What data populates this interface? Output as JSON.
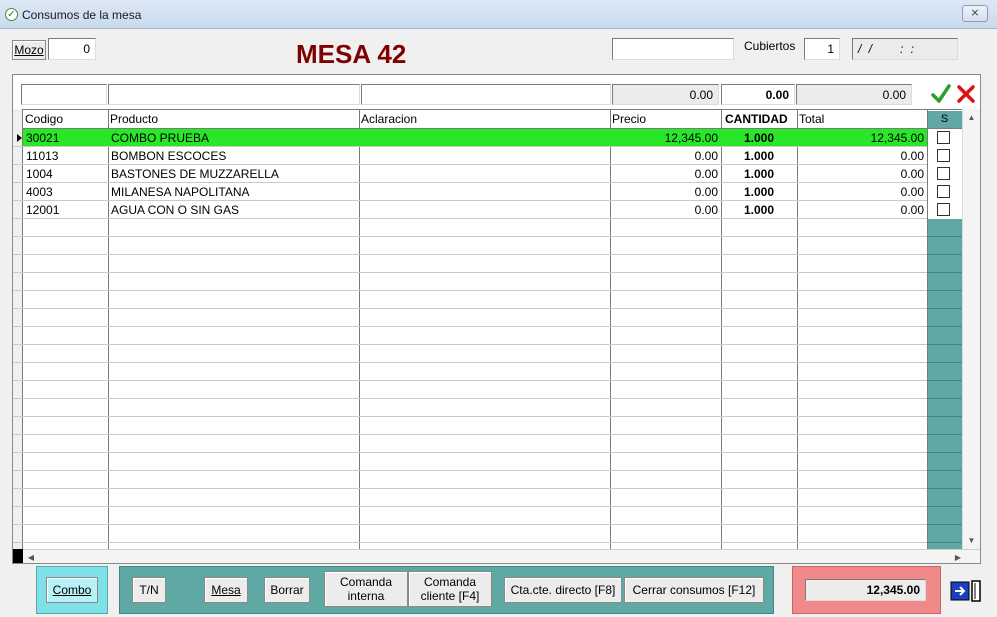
{
  "window": {
    "title": "Consumos de la mesa",
    "close_label": "⨯"
  },
  "header": {
    "mozo_label": "Mozo",
    "mozo_value": "0",
    "mesa_title": "MESA 42",
    "top_field": "",
    "cubiertos_label": "Cubiertos",
    "cubiertos_value": "1",
    "date_value": "/ /",
    "time_value": ": :"
  },
  "entry": {
    "codigo": "",
    "producto": "",
    "aclaracion": "",
    "precio": "0.00",
    "cantidad": "0.00",
    "total": "0.00",
    "confirm_icon": "check-icon",
    "cancel_icon": "x-icon"
  },
  "columns": [
    "Codigo",
    "Producto",
    "Aclaracion",
    "Precio",
    "CANTIDAD",
    "Total",
    "S"
  ],
  "rows": [
    {
      "codigo": "30021",
      "producto": "COMBO PRUEBA",
      "aclaracion": "",
      "precio": "12,345.00",
      "cantidad": "1.000",
      "total": "12,345.00",
      "selected": true
    },
    {
      "codigo": "11013",
      "producto": "BOMBON ESCOCES",
      "aclaracion": "",
      "precio": "0.00",
      "cantidad": "1.000",
      "total": "0.00",
      "selected": false
    },
    {
      "codigo": "1004",
      "producto": "BASTONES DE MUZZARELLA",
      "aclaracion": "",
      "precio": "0.00",
      "cantidad": "1.000",
      "total": "0.00",
      "selected": false
    },
    {
      "codigo": "4003",
      "producto": "MILANESA NAPOLITANA",
      "aclaracion": "",
      "precio": "0.00",
      "cantidad": "1.000",
      "total": "0.00",
      "selected": false
    },
    {
      "codigo": "12001",
      "producto": "AGUA CON O SIN GAS",
      "aclaracion": "",
      "precio": "0.00",
      "cantidad": "1.000",
      "total": "0.00",
      "selected": false
    }
  ],
  "footer": {
    "combo": "Combo",
    "tn": "T/N",
    "mesa": "Mesa",
    "borrar": "Borrar",
    "comanda_interna_1": "Comanda",
    "comanda_interna_2": "interna",
    "comanda_cliente_1": "Comanda",
    "comanda_cliente_2": "cliente [F4]",
    "cta_cte": "Cta.cte. directo [F8]",
    "cerrar": "Cerrar consumos [F12]",
    "total": "12,345.00",
    "exit_icon": "exit-door-icon"
  },
  "colors": {
    "selected_row": "#28e628",
    "mesa_title": "#7f0000",
    "combo_panel": "#7fe0e8",
    "actions_panel": "#5fa8a3",
    "total_panel": "#f08a8a",
    "confirm": "#2e9e2e",
    "cancel": "#e01010"
  }
}
